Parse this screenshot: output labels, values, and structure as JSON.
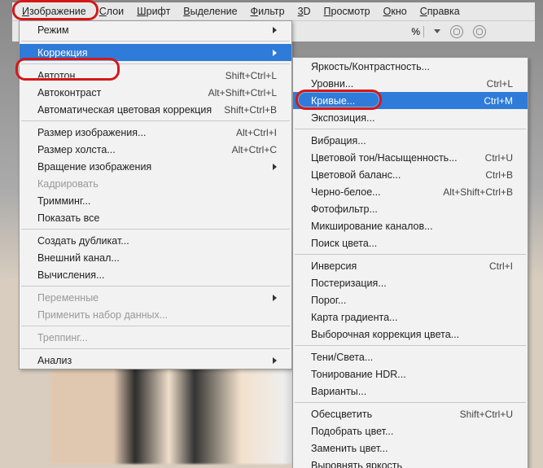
{
  "menubar": [
    {
      "label": "Изображение",
      "u": 0
    },
    {
      "label": "Слои",
      "u": 0
    },
    {
      "label": "Шрифт",
      "u": 0
    },
    {
      "label": "Выделение",
      "u": 0
    },
    {
      "label": "Фильтр",
      "u": 0
    },
    {
      "label": "3D",
      "u": 0
    },
    {
      "label": "Просмотр",
      "u": 0
    },
    {
      "label": "Окно",
      "u": 0
    },
    {
      "label": "Справка",
      "u": 0
    }
  ],
  "toolbar": {
    "percent_suffix": "%"
  },
  "left_menu": [
    {
      "label": "Режим",
      "type": "arrow"
    },
    {
      "type": "sep"
    },
    {
      "label": "Коррекция",
      "type": "arrow",
      "selected": true
    },
    {
      "type": "sep"
    },
    {
      "label": "Автотон",
      "shortcut": "Shift+Ctrl+L"
    },
    {
      "label": "Автоконтраст",
      "shortcut": "Alt+Shift+Ctrl+L"
    },
    {
      "label": "Автоматическая цветовая коррекция",
      "shortcut": "Shift+Ctrl+B"
    },
    {
      "type": "sep"
    },
    {
      "label": "Размер изображения...",
      "shortcut": "Alt+Ctrl+I"
    },
    {
      "label": "Размер холста...",
      "shortcut": "Alt+Ctrl+C"
    },
    {
      "label": "Вращение изображения",
      "type": "arrow"
    },
    {
      "label": "Кадрировать",
      "disabled": true
    },
    {
      "label": "Тримминг..."
    },
    {
      "label": "Показать все"
    },
    {
      "type": "sep"
    },
    {
      "label": "Создать дубликат..."
    },
    {
      "label": "Внешний канал..."
    },
    {
      "label": "Вычисления..."
    },
    {
      "type": "sep"
    },
    {
      "label": "Переменные",
      "type": "arrow",
      "disabled": true
    },
    {
      "label": "Применить набор данных...",
      "disabled": true
    },
    {
      "type": "sep"
    },
    {
      "label": "Треппинг...",
      "disabled": true
    },
    {
      "type": "sep"
    },
    {
      "label": "Анализ",
      "type": "arrow"
    }
  ],
  "right_menu": [
    {
      "label": "Яркость/Контрастность..."
    },
    {
      "label": "Уровни...",
      "shortcut": "Ctrl+L"
    },
    {
      "label": "Кривые...",
      "shortcut": "Ctrl+M",
      "selected": true
    },
    {
      "label": "Экспозиция..."
    },
    {
      "type": "sep"
    },
    {
      "label": "Вибрация..."
    },
    {
      "label": "Цветовой тон/Насыщенность...",
      "shortcut": "Ctrl+U"
    },
    {
      "label": "Цветовой баланс...",
      "shortcut": "Ctrl+B"
    },
    {
      "label": "Черно-белое...",
      "shortcut": "Alt+Shift+Ctrl+B"
    },
    {
      "label": "Фотофильтр..."
    },
    {
      "label": "Микширование каналов..."
    },
    {
      "label": "Поиск цвета..."
    },
    {
      "type": "sep"
    },
    {
      "label": "Инверсия",
      "shortcut": "Ctrl+I"
    },
    {
      "label": "Постеризация..."
    },
    {
      "label": "Порог..."
    },
    {
      "label": "Карта градиента..."
    },
    {
      "label": "Выборочная коррекция цвета..."
    },
    {
      "type": "sep"
    },
    {
      "label": "Тени/Света..."
    },
    {
      "label": "Тонирование HDR..."
    },
    {
      "label": "Варианты..."
    },
    {
      "type": "sep"
    },
    {
      "label": "Обесцветить",
      "shortcut": "Shift+Ctrl+U"
    },
    {
      "label": "Подобрать цвет..."
    },
    {
      "label": "Заменить цвет..."
    },
    {
      "label": "Выровнять яркость"
    }
  ]
}
